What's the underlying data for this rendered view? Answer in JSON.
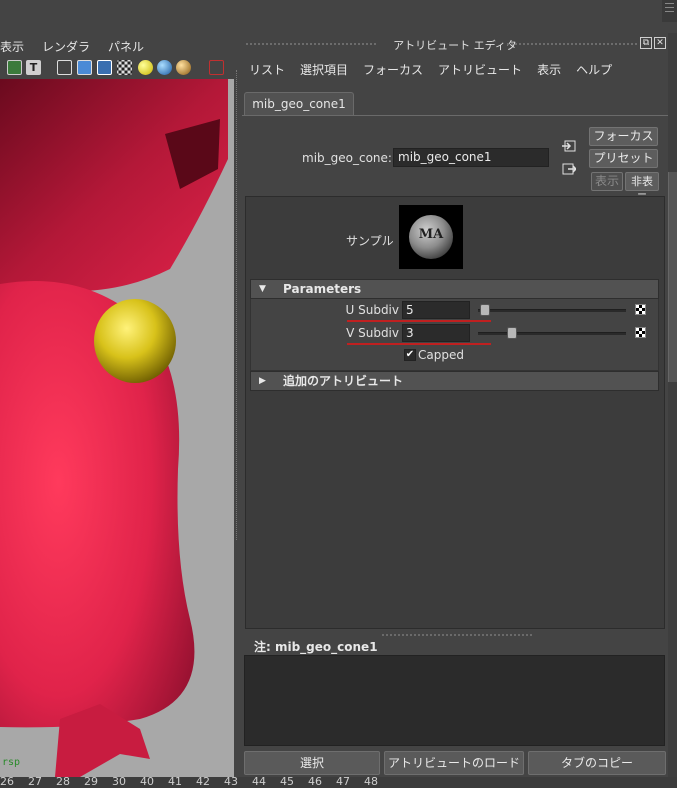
{
  "viewport": {
    "menu": [
      "表示",
      "レンダラ",
      "パネル"
    ],
    "camera_label": "rsp"
  },
  "timeline": {
    "numbers": [
      "26",
      "27",
      "28",
      "29",
      "30",
      "40",
      "41",
      "42",
      "43",
      "44",
      "45",
      "46",
      "47",
      "48"
    ]
  },
  "attribute_editor": {
    "title": "アトリビュート エディタ",
    "menu": [
      "リスト",
      "選択項目",
      "フォーカス",
      "アトリビュート",
      "表示",
      "ヘルプ"
    ],
    "tab_label": "mib_geo_cone1",
    "node_label": "mib_geo_cone:",
    "node_value": "mib_geo_cone1",
    "buttons": {
      "focus": "フォーカス",
      "preset": "プリセット",
      "show": "表示",
      "hide": "非表示"
    },
    "sample_label": "サンプル",
    "sample_logo": "MA",
    "sections": {
      "parameters": "Parameters",
      "extra_attributes": "追加のアトリビュート"
    },
    "attributes": {
      "u_subdiv_label": "U Subdiv",
      "u_subdiv_value": "5",
      "v_subdiv_label": "V Subdiv",
      "v_subdiv_value": "3",
      "capped_label": "Capped",
      "capped_checked": true
    },
    "notes_label": "注:  mib_geo_cone1",
    "bottom_buttons": {
      "select": "選択",
      "load_attributes": "アトリビュートのロード",
      "copy_tab": "タブのコピー"
    }
  },
  "colors": {
    "model_red": "#e8264a",
    "sphere_yellow": "#d8c21a",
    "viewport_bg": "#a8a8a8",
    "panel_bg": "#444444",
    "field_bg": "#2b2b2b",
    "underline_red": "#c02020"
  }
}
